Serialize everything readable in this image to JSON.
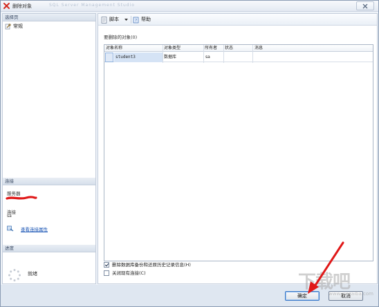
{
  "window": {
    "title": "删除对象",
    "title_ghost_text": "SQL Server Management Studio"
  },
  "left_panel": {
    "select_page": {
      "header": "选择页",
      "items": [
        {
          "label": "常规",
          "icon": "wrench-page-icon"
        }
      ]
    },
    "connection": {
      "header": "连接",
      "server_label": "服务器",
      "connection_label": "连接",
      "connection_value": "sa",
      "view_properties_link": "查看连接属性"
    },
    "progress": {
      "header": "进度",
      "status": "就绪"
    }
  },
  "toolbar": {
    "script_label": "脚本",
    "help_label": "帮助"
  },
  "objects_section": {
    "label": "要删除的对象(0)",
    "columns": [
      "对象名称",
      "对象类型",
      "所有者",
      "状态",
      "消息"
    ],
    "rows": [
      {
        "name": "student3",
        "type": "数据库",
        "owner": "sa",
        "status": "",
        "message": ""
      }
    ]
  },
  "options": {
    "delete_backup_history": {
      "label": "删除数据库备份和还原历史记录信息(H)",
      "checked": true
    },
    "close_connections": {
      "label": "关闭现有连接(C)",
      "checked": false
    }
  },
  "buttons": {
    "ok": "确定",
    "cancel": "取消"
  },
  "watermark": {
    "main": "下载吧",
    "sub": "www.xiazaiba.com"
  },
  "colors": {
    "accent": "#3b79c9",
    "annotation_arrow": "#e01818",
    "redaction": "#e01818"
  }
}
